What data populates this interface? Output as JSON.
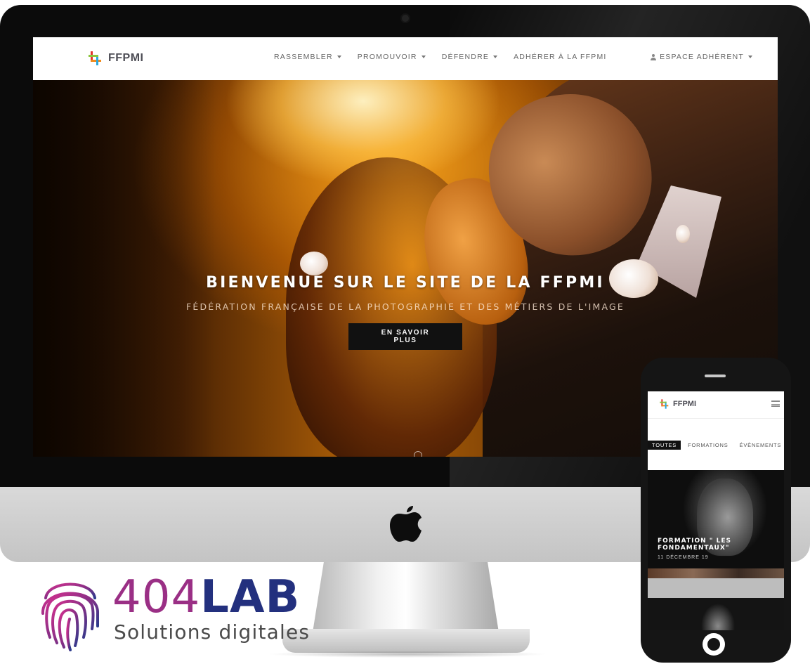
{
  "desktop": {
    "logo_text": "FFPMI",
    "nav": [
      {
        "label": "RASSEMBLER",
        "has_dropdown": true
      },
      {
        "label": "PROMOUVOIR",
        "has_dropdown": true
      },
      {
        "label": "DÉFENDRE",
        "has_dropdown": true
      },
      {
        "label": "ADHÉRER À LA FFPMI",
        "has_dropdown": false
      }
    ],
    "member_label": "ESPACE ADHÉRENT",
    "hero": {
      "title": "BIENVENUE SUR LE SITE DE LA FFPMI",
      "subtitle": "FÉDÉRATION FRANÇAISE DE LA PHOTOGRAPHIE ET DES MÉTIERS DE L'IMAGE",
      "button": "EN SAVOIR PLUS"
    }
  },
  "mobile": {
    "logo_text": "FFPMI",
    "tabs": [
      {
        "label": "TOUTES",
        "active": true
      },
      {
        "label": "FORMATIONS",
        "active": false
      },
      {
        "label": "ÉVÈNEMENTS",
        "active": false
      }
    ],
    "card": {
      "title": "FORMATION \" LES FONDAMENTAUX\"",
      "date": "11 DÉCEMBRE 19"
    }
  },
  "branding": {
    "word_404": "404",
    "word_lab": "LAB",
    "tagline": "Solutions digitales"
  },
  "colors": {
    "brand_purple": "#9a2f85",
    "brand_navy": "#23307e",
    "logo_orange": "#f18a1c",
    "logo_red": "#e5332a",
    "logo_green": "#8cc63f",
    "logo_blue": "#29a8e0"
  },
  "icons": {
    "member": "user-icon",
    "menu": "hamburger-icon",
    "hardware": "apple-logo"
  }
}
